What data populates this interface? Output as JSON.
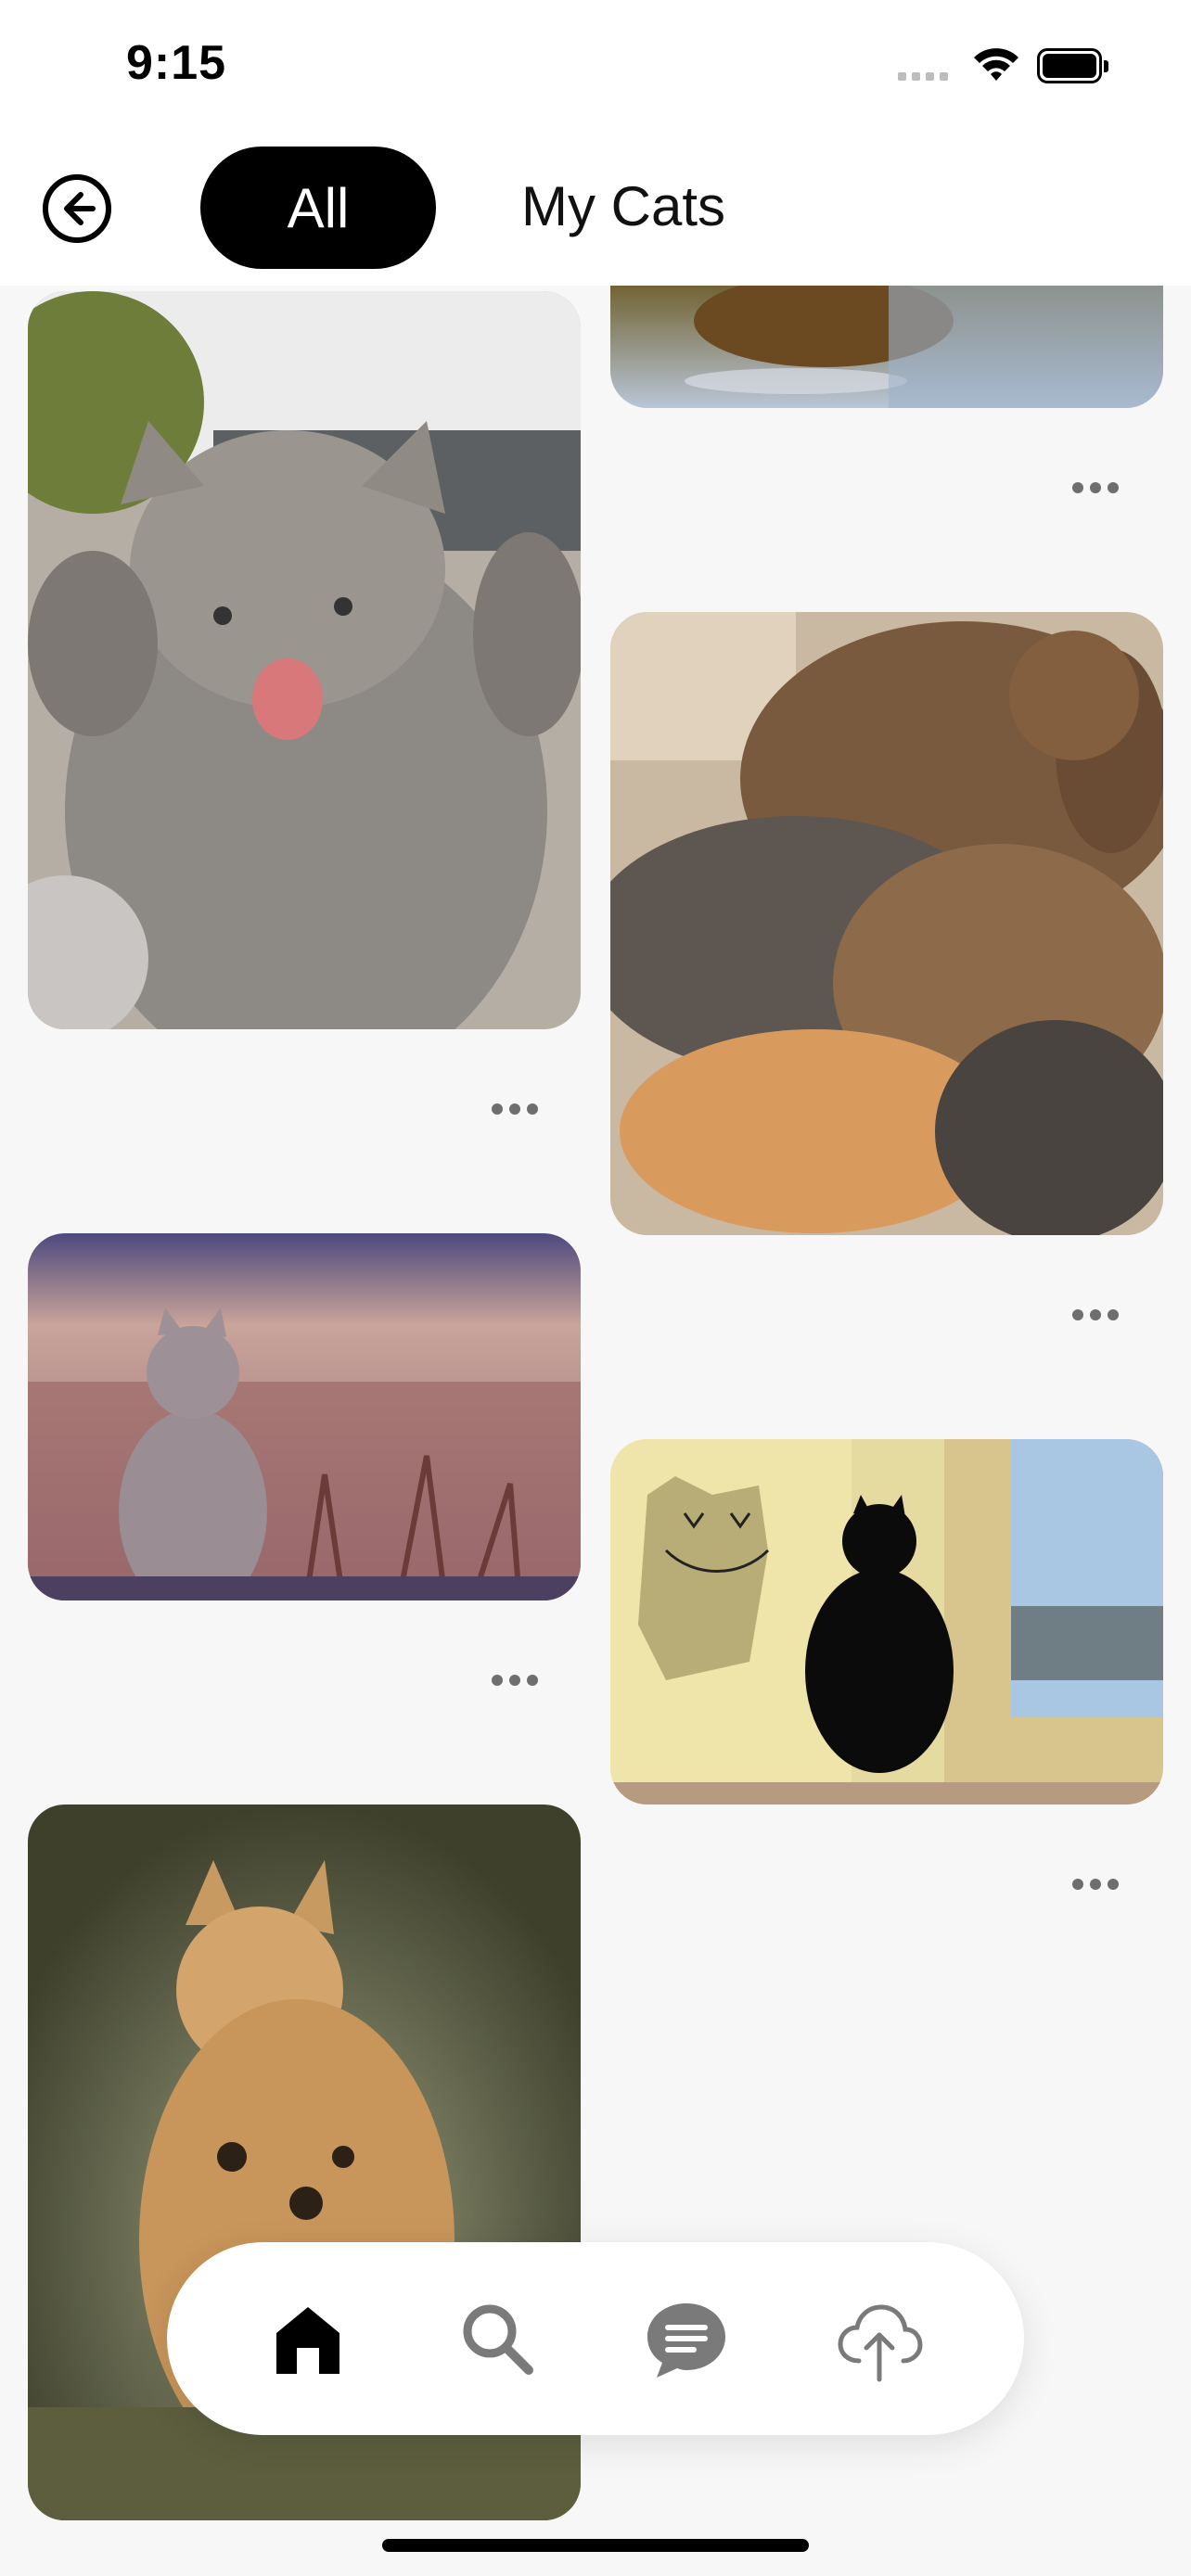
{
  "status_bar": {
    "time": "9:15"
  },
  "header": {
    "tabs": [
      {
        "label": "All",
        "selected": true
      },
      {
        "label": "My Cats",
        "selected": false
      }
    ]
  },
  "feed": {
    "items": [
      {
        "name": "partial-top-cat-photo",
        "column": "right",
        "subject": "cat near water"
      },
      {
        "name": "gray-kitten-photo",
        "column": "left",
        "subject": "gray kitten with paws up"
      },
      {
        "name": "sleeping-kittens-photo",
        "column": "right",
        "subject": "pile of sleeping kittens"
      },
      {
        "name": "cat-in-field-photo",
        "column": "left",
        "subject": "fluffy cat sitting in field"
      },
      {
        "name": "black-cat-window-photo",
        "column": "right",
        "subject": "black cat by window with drawn shadow"
      },
      {
        "name": "spotted-cat-photo",
        "column": "left",
        "subject": "spotted bengal cat"
      }
    ]
  },
  "icons": {
    "back": "arrow-left-circle-icon",
    "more": "ellipsis-icon",
    "home": "home-icon",
    "search": "search-icon",
    "messages": "chat-bubble-icon",
    "upload": "cloud-upload-icon"
  },
  "colors": {
    "accent": "#000000",
    "inactive_icon": "#7a7a7a",
    "background": "#f7f7f7"
  }
}
